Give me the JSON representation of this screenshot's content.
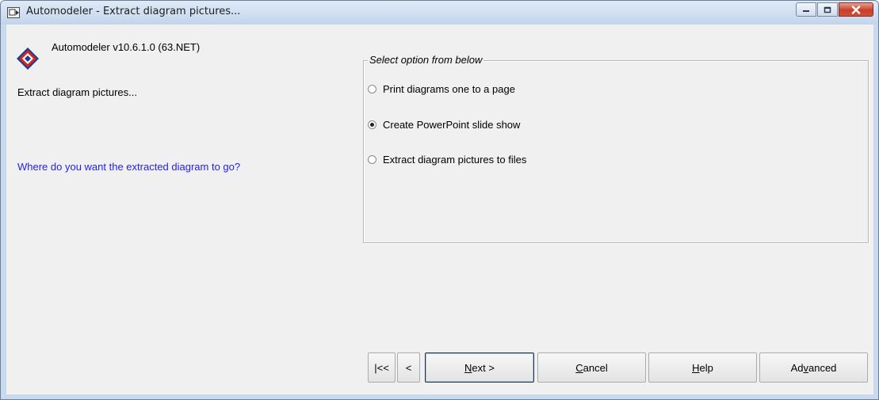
{
  "window": {
    "title": "Automodeler - Extract diagram pictures...",
    "icons": {
      "app": "app-icon",
      "minimize": "minimize-icon",
      "maximize": "maximize-icon",
      "close": "close-icon"
    }
  },
  "header": {
    "version": "Automodeler v10.6.1.0 (63.NET)",
    "logo": "automodeler-logo-icon"
  },
  "left": {
    "page_heading": "Extract diagram pictures...",
    "question": "Where do you want the extracted diagram to go?"
  },
  "options": {
    "legend": "Select option from below",
    "items": [
      {
        "label": "Print diagrams one to a page",
        "selected": false
      },
      {
        "label": "Create PowerPoint slide show",
        "selected": true
      },
      {
        "label": "Extract diagram pictures to files",
        "selected": false
      }
    ]
  },
  "buttons": {
    "first": "|<<",
    "back": "<",
    "next": {
      "pre": "",
      "key": "N",
      "post": "ext >"
    },
    "cancel": {
      "pre": "",
      "key": "C",
      "post": "ancel"
    },
    "help": {
      "pre": "",
      "key": "H",
      "post": "elp"
    },
    "advanced": {
      "pre": "Ad",
      "key": "v",
      "post": "anced"
    }
  },
  "colors": {
    "question_text": "#2222e8",
    "titlebar": "#c9daee",
    "close_button": "#c6402a"
  }
}
